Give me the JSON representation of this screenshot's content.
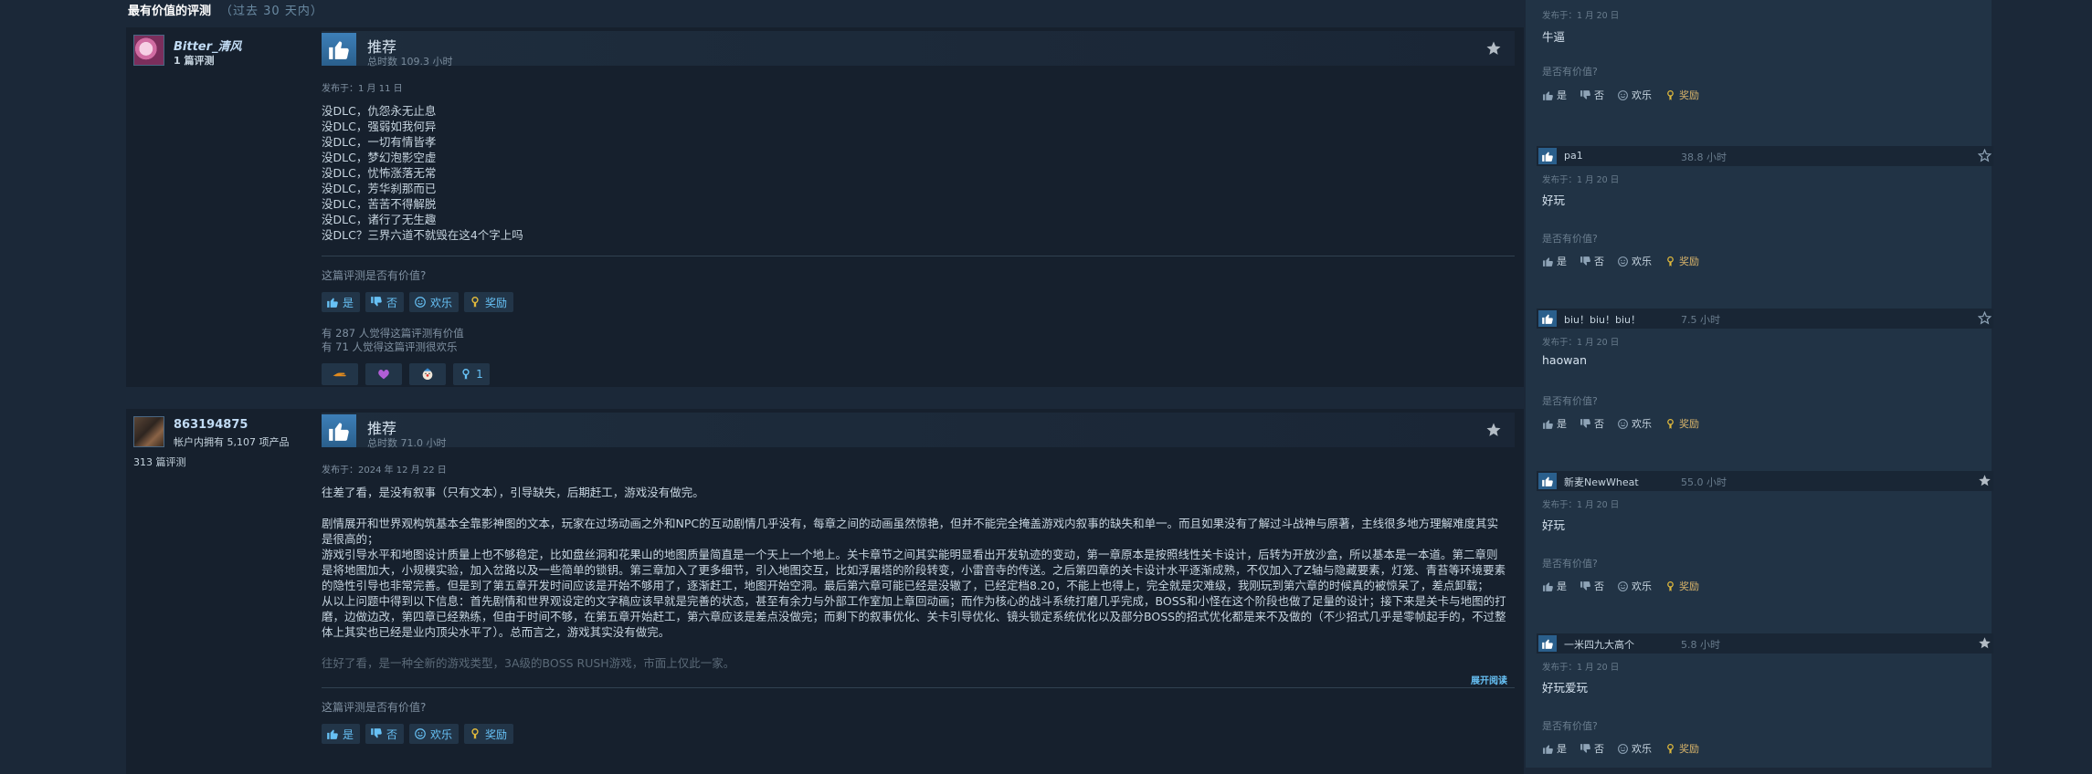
{
  "section": {
    "title": "最有价值的评测",
    "subtitle": "（过去 30 天内）"
  },
  "reviews": [
    {
      "author": "Bitter_清风",
      "author_lines": [
        "1 篇评测"
      ],
      "extra_line": "",
      "verdict": "推荐",
      "hours": "总时数 109.3 小时",
      "posted": "发布于：1 月 11 日",
      "lines": [
        "没DLC，仇怨永无止息",
        "没DLC，强弱如我何异",
        "没DLC，一切有情皆孝",
        "没DLC，梦幻泡影空虚",
        "没DLC，忧怖涨落无常",
        "没DLC，芳华刹那而已",
        "没DLC，苦苦不得解脱",
        "没DLC，诸行了无生趣",
        "没DLC？三界六道不就毁在这4个字上吗"
      ],
      "helpful_question": "这篇评测是否有价值?",
      "buttons": {
        "yes": "是",
        "no": "否",
        "funny": "欢乐",
        "award": "奖励"
      },
      "stat_helpful": "有 287 人觉得这篇评测有价值",
      "stat_funny": "有 71 人觉得这篇评测很欢乐",
      "award_count": "1"
    },
    {
      "author": "863194875",
      "author_lines": [
        "帐户内拥有 5,107 项产品"
      ],
      "extra_line": "313 篇评测",
      "verdict": "推荐",
      "hours": "总时数 71.0 小时",
      "posted": "发布于：2024 年 12 月 22 日",
      "lines": [
        "往差了看，是没有叙事（只有文本），引导缺失，后期赶工，游戏没有做完。",
        "",
        "剧情展开和世界观构筑基本全靠影神图的文本，玩家在过场动画之外和NPC的互动剧情几乎没有，每章之间的动画虽然惊艳，但并不能完全掩盖游戏内叙事的缺失和单一。而且如果没有了解过斗战神与原著，主线很多地方理解难度其实是很高的；",
        "游戏引导水平和地图设计质量上也不够稳定，比如盘丝洞和花果山的地图质量简直是一个天上一个地上。关卡章节之间其实能明显看出开发轨迹的变动，第一章原本是按照线性关卡设计，后转为开放沙盒，所以基本是一本道。第二章则是将地图加大，小规模实验，加入岔路以及一些简单的锁钥。第三章加入了更多细节，引入地图交互，比如浮屠塔的阶段转变，小雷音寺的传送。之后第四章的关卡设计水平逐渐成熟，不仅加入了Z轴与隐藏要素，灯笼、青苔等环境要素的隐性引导也非常完善。但是到了第五章开发时间应该是开始不够用了，逐渐赶工，地图开始空洞。最后第六章可能已经是没辙了，已经定档8.20，不能上也得上，完全就是灾难级，我刚玩到第六章的时候真的被惊呆了，差点卸载；",
        "从以上问题中得到以下信息：首先剧情和世界观设定的文字稿应该早就是完善的状态，甚至有余力与外部工作室加上章回动画；而作为核心的战斗系统打磨几乎完成，BOSS和小怪在这个阶段也做了足量的设计；接下来是关卡与地图的打磨，边做边改，第四章已经熟练，但由于时间不够，在第五章开始赶工，第六章应该是差点没做完；而剩下的叙事优化、关卡引导优化、镜头锁定系统优化以及部分BOSS的招式优化都是来不及做的（不少招式几乎是零帧起手的，不过整体上其实也已经是业内顶尖水平了）。总而言之，游戏其实没有做完。",
        "",
        "往好了看，是一种全新的游戏类型，3A级的BOSS RUSH游戏，市面上仅此一家。"
      ],
      "read_more": "展开阅读",
      "helpful_question": "这篇评测是否有价值?",
      "buttons": {
        "yes": "是",
        "no": "否",
        "funny": "欢乐",
        "award": "奖励"
      }
    }
  ],
  "recent": [
    {
      "name": "",
      "hours": "",
      "posted": "发布于：1 月 20 日",
      "text": "牛逼",
      "q": "是否有价值?",
      "yes": "是",
      "no": "否",
      "funny": "欢乐",
      "award": "奖励"
    },
    {
      "name": "pa1",
      "hours": "38.8 小时",
      "posted": "发布于：1 月 20 日",
      "text": "好玩",
      "q": "是否有价值?",
      "yes": "是",
      "no": "否",
      "funny": "欢乐",
      "award": "奖励"
    },
    {
      "name": "biu！biu！biu！",
      "hours": "7.5 小时",
      "posted": "发布于：1 月 20 日",
      "text": "haowan",
      "q": "是否有价值?",
      "yes": "是",
      "no": "否",
      "funny": "欢乐",
      "award": "奖励"
    },
    {
      "name": "新麦NewWheat",
      "hours": "55.0 小时",
      "posted": "发布于：1 月 20 日",
      "text": "好玩",
      "q": "是否有价值?",
      "yes": "是",
      "no": "否",
      "funny": "欢乐",
      "award": "奖励"
    },
    {
      "name": "一米四九大高个",
      "hours": "5.8 小时",
      "posted": "发布于：1 月 20 日",
      "text": "好玩爱玩",
      "q": "是否有价值?",
      "yes": "是",
      "no": "否",
      "funny": "欢乐",
      "award": "奖励"
    }
  ]
}
